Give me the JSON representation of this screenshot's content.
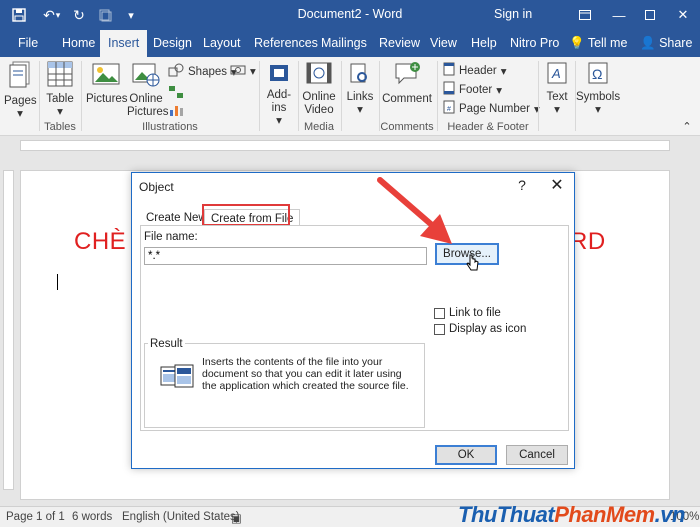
{
  "window": {
    "title": "Document2 - Word",
    "signin": "Sign in"
  },
  "quick_access": [
    "save-icon",
    "undo-icon",
    "redo-icon",
    "dropdown-icon",
    "touch-mode-icon",
    "customize-icon"
  ],
  "tabs": [
    "File",
    "Home",
    "Insert",
    "Design",
    "Layout",
    "References",
    "Mailings",
    "Review",
    "View",
    "Help",
    "Nitro Pro"
  ],
  "active_tab": "Insert",
  "tell_me": "Tell me",
  "share": "Share",
  "ribbon": {
    "pages": "Pages",
    "table": "Table",
    "pictures": "Pictures",
    "online_pictures": "Online Pictures",
    "shapes": "Shapes",
    "addins": "Add-ins",
    "online_video": "Online Video",
    "links": "Links",
    "comment": "Comment",
    "header": "Header",
    "footer": "Footer",
    "page_number": "Page Number",
    "text": "Text",
    "symbols": "Symbols",
    "groups": {
      "tables": "Tables",
      "illustrations": "Illustrations",
      "media": "Media",
      "comments": "Comments",
      "header_footer": "Header & Footer"
    }
  },
  "document": {
    "text_left": "CHÈ",
    "text_right": "RD"
  },
  "dialog": {
    "title": "Object",
    "help": "?",
    "close": "✕",
    "tab_create_new": "Create New",
    "tab_create_from_file": "Create from File",
    "file_name_label": "File name:",
    "file_name_value": "*.*",
    "browse": "Browse...",
    "link_to_file": "Link to file",
    "display_as_icon": "Display as icon",
    "result_label": "Result",
    "result_text": "Inserts the contents of the file into your document so that you can edit it later using the application which created the source file.",
    "ok": "OK",
    "cancel": "Cancel"
  },
  "status": {
    "page": "Page 1 of 1",
    "words": "6 words",
    "language": "English (United States)",
    "zoom": "100%"
  },
  "watermark": {
    "part1": "ThuThuat",
    "part2": "PhanMem",
    "part3": ".vn"
  },
  "colors": {
    "word_blue": "#2b579a",
    "doc_red": "#e02020",
    "highlight_red": "#e03a3a"
  }
}
